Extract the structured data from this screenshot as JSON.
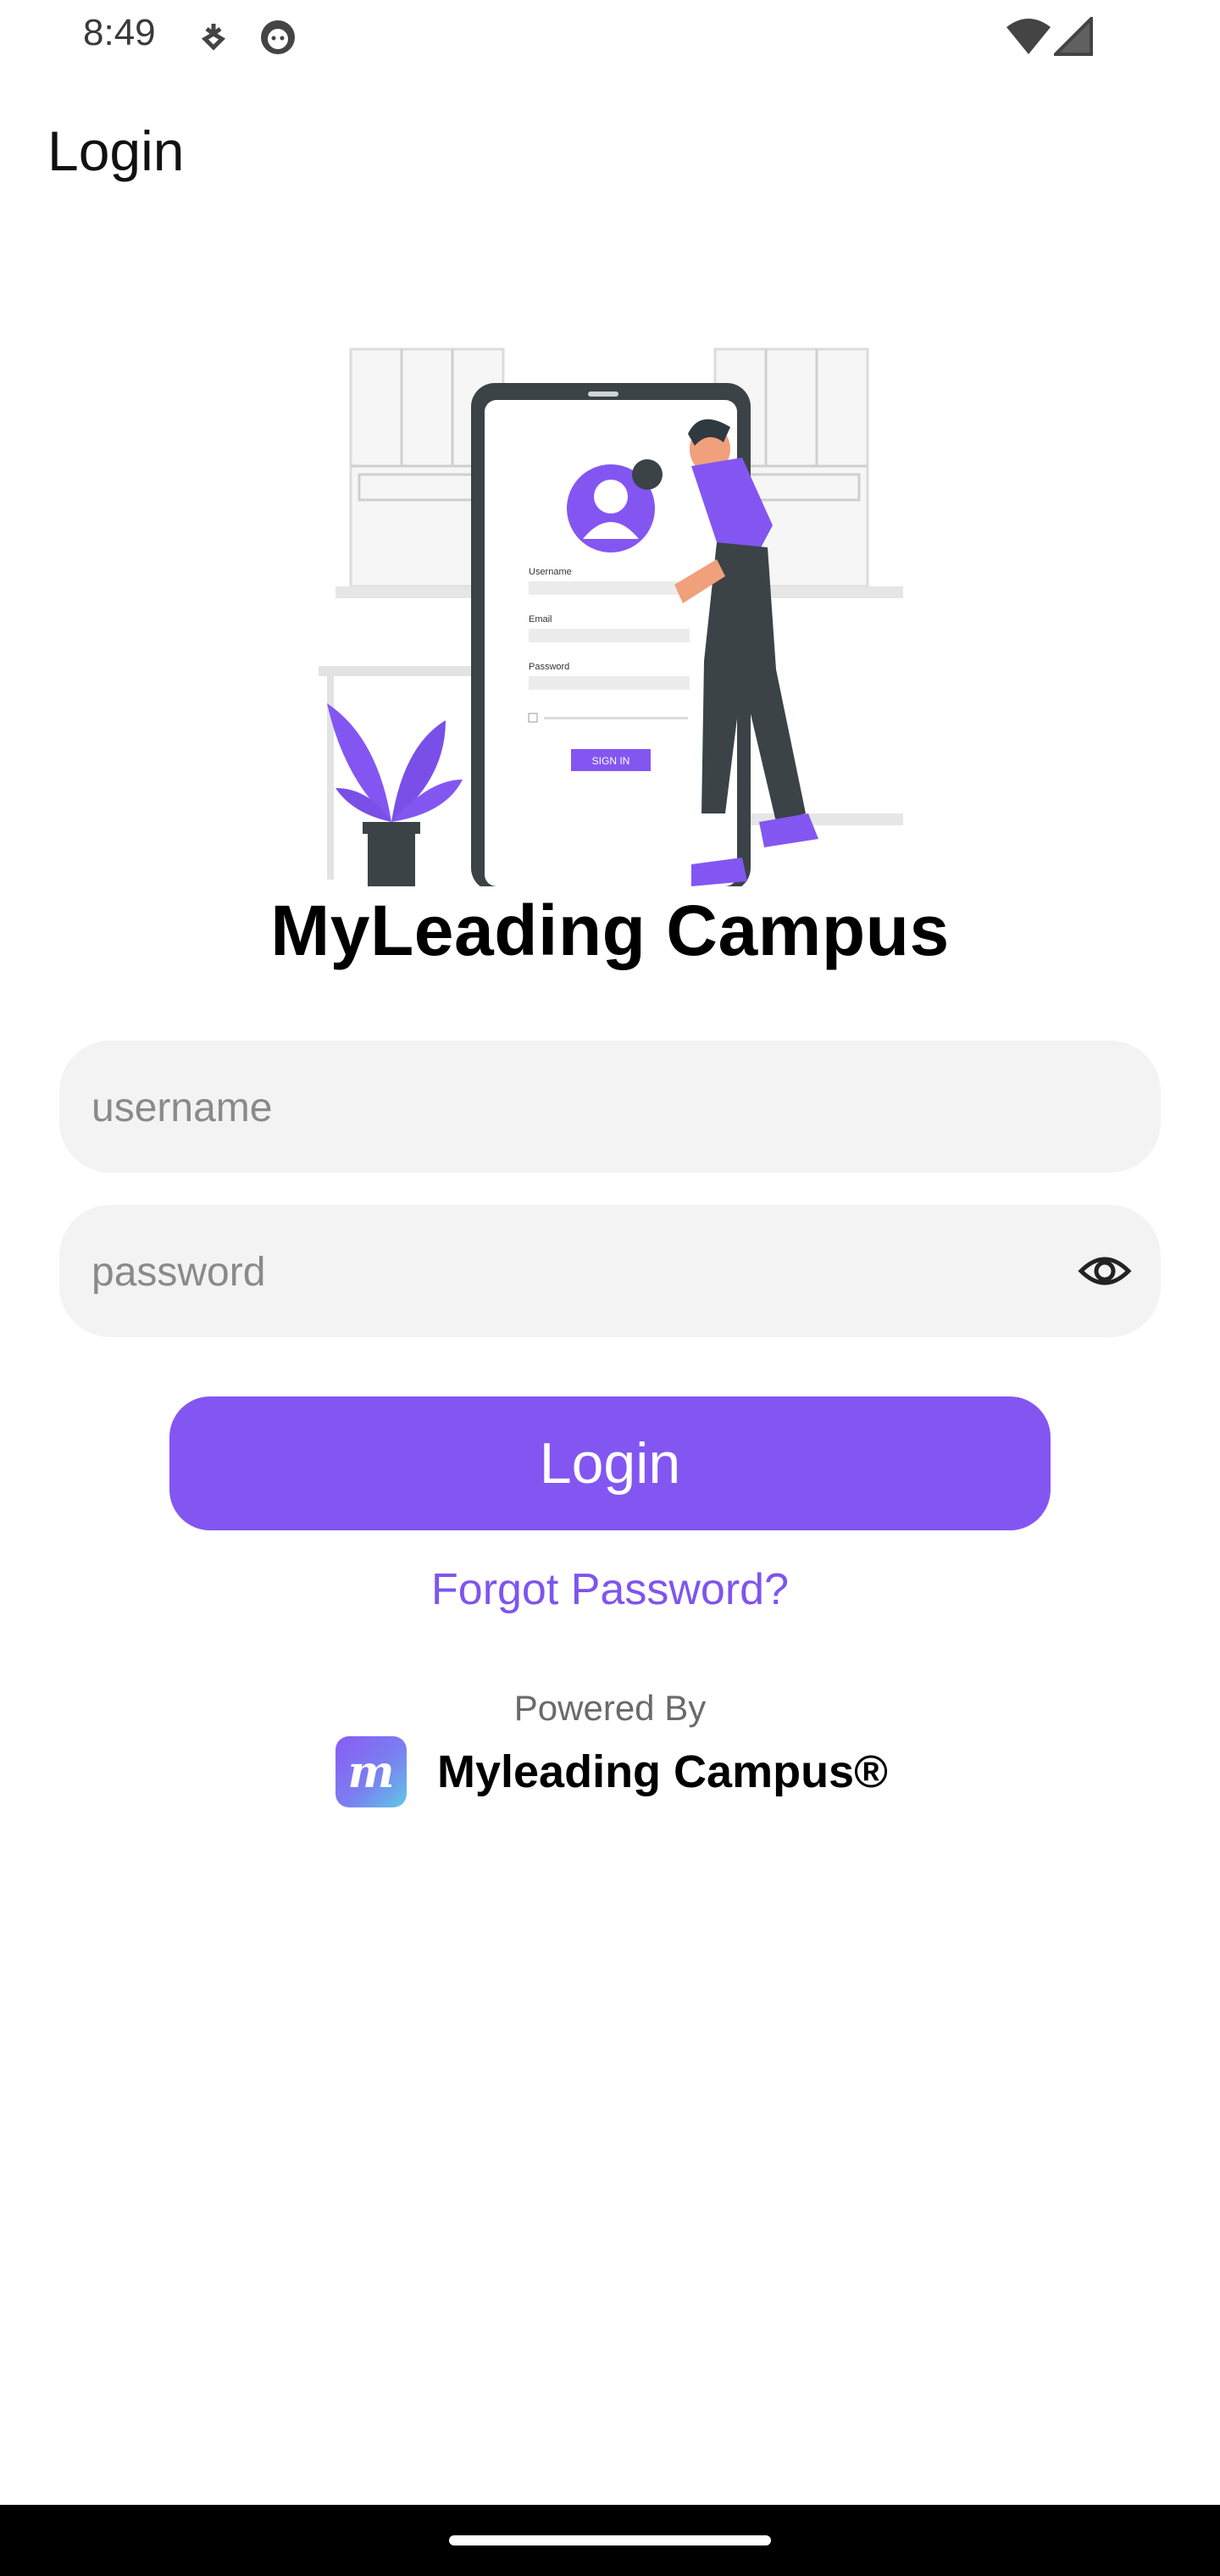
{
  "status_bar": {
    "time": "8:49",
    "icons": [
      "usb-debug-icon",
      "notification-face-icon",
      "wifi-icon",
      "cellular-signal-icon"
    ]
  },
  "app_bar": {
    "title": "Login"
  },
  "illustration": {
    "description_icon": "login-illustration",
    "texts": [
      "Username",
      "Email",
      "Password",
      "SIGN IN"
    ]
  },
  "app_name": "MyLeading Campus",
  "form": {
    "username_placeholder": "username",
    "username_value": "",
    "password_placeholder": "password",
    "password_value": "",
    "visibility_icon": "eye-icon",
    "login_label": "Login",
    "forgot_label": "Forgot Password?"
  },
  "footer": {
    "powered_by": "Powered By",
    "brand_logo_letter": "m",
    "brand_name": "Myleading Campus®"
  },
  "colors": {
    "accent": "#8356f2",
    "link": "#7e55ee",
    "field_bg": "#f3f3f3"
  }
}
